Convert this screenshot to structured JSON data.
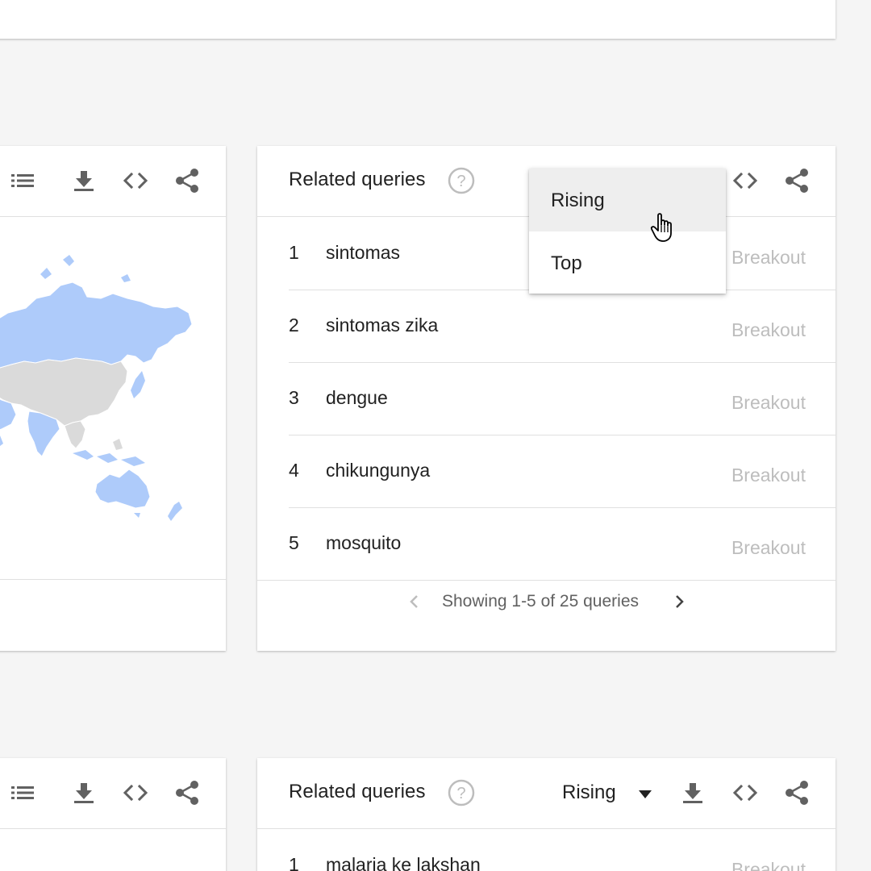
{
  "colors": {
    "page_bg": "#f5f5f5",
    "card_bg": "#ffffff",
    "map_highlight": "#aecbfa",
    "map_gray": "#dadada",
    "text": "#212121",
    "muted": "#bdbdbd"
  },
  "icons": [
    "list-icon",
    "download-icon",
    "embed-code-icon",
    "share-icon",
    "help-icon",
    "caret-down-icon",
    "chevron-left-icon",
    "chevron-right-icon",
    "hand-cursor-icon"
  ],
  "related_queries": {
    "title": "Related queries",
    "rows": [
      {
        "rank": "1",
        "query": "sintomas",
        "value": "Breakout"
      },
      {
        "rank": "2",
        "query": "sintomas zika",
        "value": "Breakout"
      },
      {
        "rank": "3",
        "query": "dengue",
        "value": "Breakout"
      },
      {
        "rank": "4",
        "query": "chikungunya",
        "value": "Breakout"
      },
      {
        "rank": "5",
        "query": "mosquito",
        "value": "Breakout"
      }
    ],
    "pagination": "Showing 1-5 of 25 queries"
  },
  "menu": {
    "options": [
      "Rising",
      "Top"
    ],
    "hovered": "Rising"
  },
  "related_queries_bottom": {
    "title": "Related queries",
    "dropdown_value": "Rising",
    "rows": [
      {
        "rank": "1",
        "query": "malaria ke lakshan",
        "value": "Breakout"
      }
    ]
  }
}
